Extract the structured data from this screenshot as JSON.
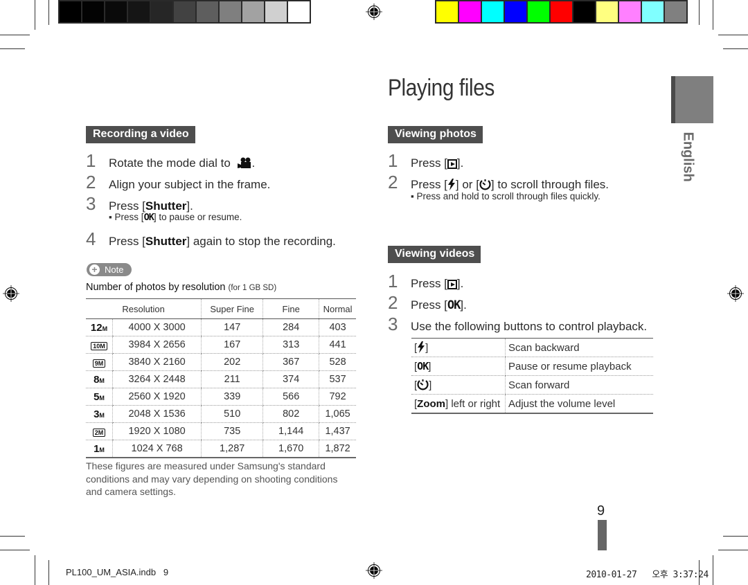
{
  "print_marks": {
    "grayscale_swatches": [
      "#000000",
      "#030303",
      "#0a0a0a",
      "#151515",
      "#262626",
      "#424242",
      "#5e5e5e",
      "#7f7f7f",
      "#a2a2a2",
      "#d0d0d0",
      "#ffffff"
    ],
    "color_swatches": [
      "#ffff00",
      "#ff00ff",
      "#00ffff",
      "#0000ff",
      "#00ff00",
      "#ff0000",
      "#000000",
      "#ffff80",
      "#ff80ff",
      "#80ffff",
      "#808080"
    ],
    "footer_file": "PL100_UM_ASIA.indb   9",
    "footer_timestamp": "2010-01-27   오후 3:37:24"
  },
  "page": {
    "title": "Playing files",
    "language_tab": "English",
    "page_number": "9"
  },
  "recording": {
    "header": "Recording a video",
    "steps": [
      {
        "num": "1",
        "text": "Rotate the mode dial to",
        "icon": "movie-camera-icon",
        "suffix": "."
      },
      {
        "num": "2",
        "text": "Align your subject in the frame."
      },
      {
        "num": "3",
        "pre": "Press [",
        "key": "Shutter",
        "post": "]."
      },
      {
        "num": "4",
        "pre": "Press [",
        "key": "Shutter",
        "post": "] again to stop the recording."
      }
    ],
    "sub_bullet": {
      "pre": "Press [",
      "key": "OK",
      "post": "] to pause or resume."
    }
  },
  "note": {
    "label": "Note",
    "heading": "Number of photos by resolution",
    "heading_small": "(for 1 GB SD)",
    "columns": [
      "Resolution",
      "Super Fine",
      "Fine",
      "Normal"
    ],
    "rows": [
      {
        "icon": "12M",
        "res": "4000 X 3000",
        "sf": "147",
        "f": "284",
        "n": "403"
      },
      {
        "icon": "10M",
        "res": "3984 X 2656",
        "sf": "167",
        "f": "313",
        "n": "441"
      },
      {
        "icon": "9M",
        "res": "3840 X 2160",
        "sf": "202",
        "f": "367",
        "n": "528"
      },
      {
        "icon": "8M",
        "res": "3264 X 2448",
        "sf": "211",
        "f": "374",
        "n": "537"
      },
      {
        "icon": "5M",
        "res": "2560 X 1920",
        "sf": "339",
        "f": "566",
        "n": "792"
      },
      {
        "icon": "3M",
        "res": "2048 X 1536",
        "sf": "510",
        "f": "802",
        "n": "1,065"
      },
      {
        "icon": "2M",
        "res": "1920 X 1080",
        "sf": "735",
        "f": "1,144",
        "n": "1,437"
      },
      {
        "icon": "1M",
        "res": "1024 X 768",
        "sf": "1,287",
        "f": "1,670",
        "n": "1,872"
      }
    ],
    "footnote": "These figures are measured under Samsung's standard conditions and may vary depending on shooting conditions and camera settings."
  },
  "photos": {
    "header": "Viewing photos",
    "step1": {
      "num": "1",
      "pre": "Press [",
      "post": "]."
    },
    "step2": {
      "num": "2",
      "pre": "Press [",
      "mid": "] or [",
      "post": "] to scroll through files."
    },
    "bullet": "Press and hold to scroll through files quickly."
  },
  "videos": {
    "header": "Viewing videos",
    "step1": {
      "num": "1",
      "pre": "Press [",
      "post": "]."
    },
    "step2": {
      "num": "2",
      "pre": "Press [",
      "key": "OK",
      "post": "]."
    },
    "step3": {
      "num": "3",
      "text": "Use the following buttons to control playback."
    },
    "controls": [
      {
        "button": "flash",
        "action": "Scan backward"
      },
      {
        "button": "OK",
        "action": "Pause or resume playback"
      },
      {
        "button": "timer",
        "action": "Scan forward"
      },
      {
        "button": "Zoom",
        "suffix": "] left or right",
        "action": "Adjust the volume level"
      }
    ]
  }
}
